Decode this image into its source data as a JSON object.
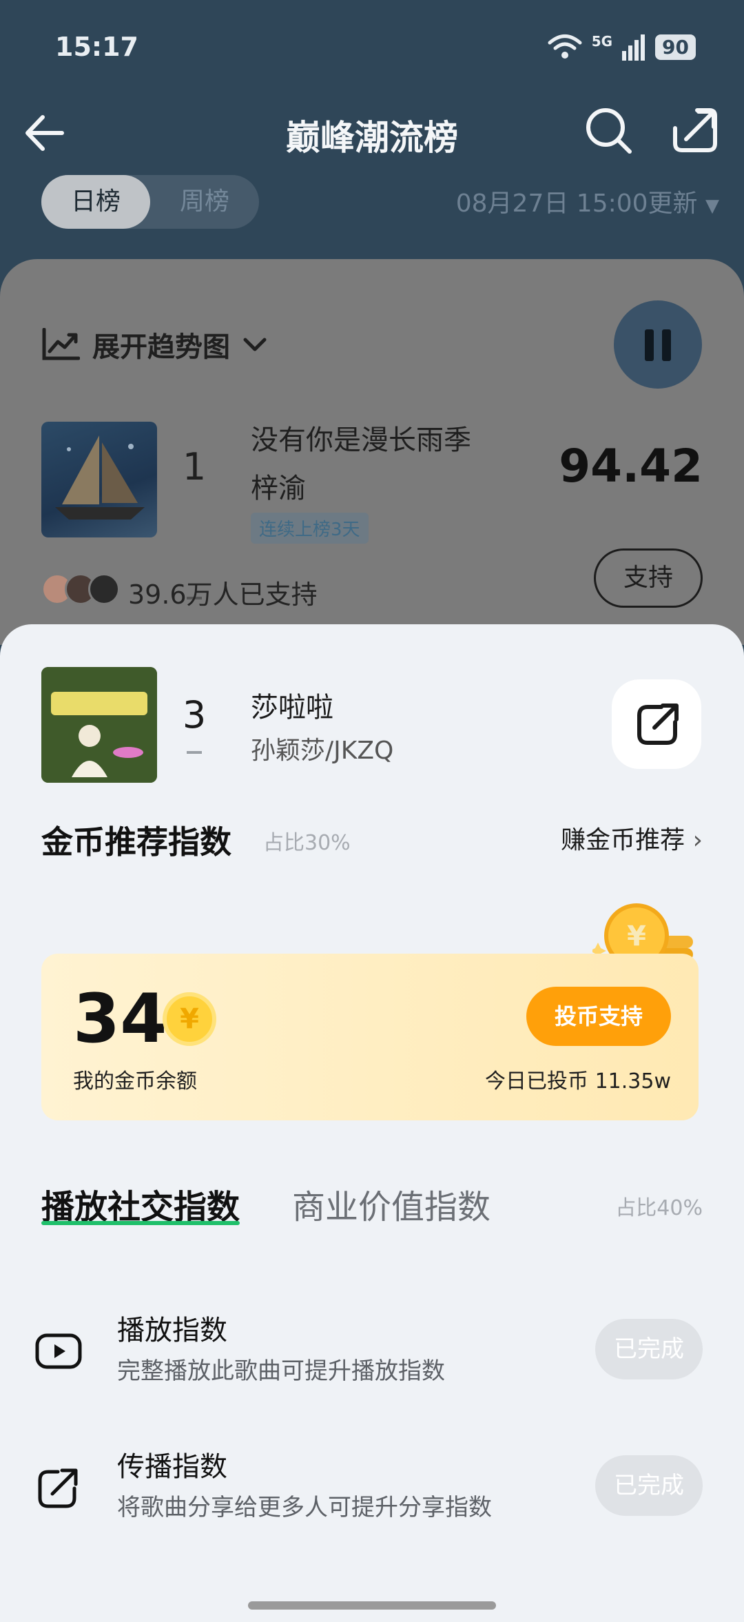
{
  "status_bar": {
    "time": "15:17",
    "network": "5G",
    "battery": "90"
  },
  "nav": {
    "title": "巅峰潮流榜"
  },
  "period_tabs": {
    "daily": "日榜",
    "weekly": "周榜"
  },
  "update_time": "08月27日 15:00更新",
  "trend": {
    "label": "展开趋势图"
  },
  "top_song": {
    "rank": "1",
    "title": "没有你是漫长雨季",
    "artist": "梓渝",
    "streak": "连续上榜3天",
    "score": "94.42",
    "supporters": "39.6万人已支持",
    "support_label": "支持"
  },
  "current_song": {
    "rank": "3",
    "title": "莎啦啦",
    "artist": "孙颖莎/JKZQ"
  },
  "coin_section": {
    "title": "金币推荐指数",
    "ratio": "占比30%",
    "earn_label": "赚金币推荐",
    "balance": "34",
    "balance_label": "我的金币余额",
    "vote_button": "投币支持",
    "today": "今日已投币 11.35w"
  },
  "index_tabs": {
    "play_social": "播放社交指数",
    "commercial": "商业价值指数",
    "ratio": "占比40%"
  },
  "tasks": [
    {
      "title": "播放指数",
      "desc": "完整播放此歌曲可提升播放指数",
      "status": "已完成",
      "icon": "play-icon"
    },
    {
      "title": "传播指数",
      "desc": "将歌曲分享给更多人可提升分享指数",
      "status": "已完成",
      "icon": "share-icon"
    }
  ],
  "colors": {
    "accent_green": "#1fbf6a",
    "coin_orange": "#ffa00a",
    "header_bg": "#2f4658"
  }
}
